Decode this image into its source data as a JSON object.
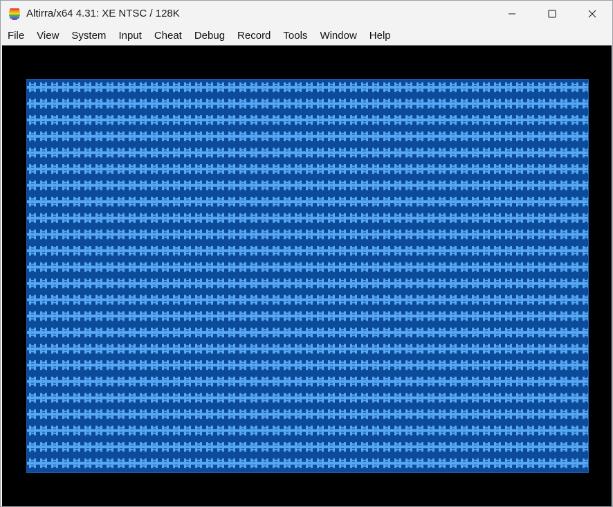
{
  "window": {
    "title": "Altirra/x64 4.31: XE NTSC / 128K",
    "app_icon": "altirra-rainbow-logo-icon",
    "controls": {
      "minimize": "minimize-icon",
      "maximize": "maximize-icon",
      "close": "close-icon"
    }
  },
  "menu": {
    "items": [
      {
        "label": "File"
      },
      {
        "label": "View"
      },
      {
        "label": "System"
      },
      {
        "label": "Input"
      },
      {
        "label": "Cheat"
      },
      {
        "label": "Debug"
      },
      {
        "label": "Record"
      },
      {
        "label": "Tools"
      },
      {
        "label": "Window"
      },
      {
        "label": "Help"
      }
    ]
  },
  "display": {
    "background_color": "#000000",
    "playfield_color": "#0c4a9a",
    "pattern_color": "#57a8f5",
    "pattern_description": "repeating light-blue chain tile pattern"
  }
}
